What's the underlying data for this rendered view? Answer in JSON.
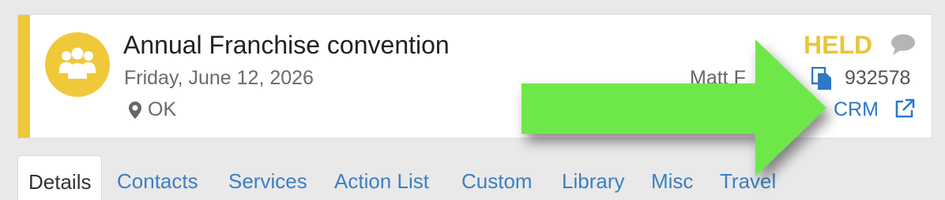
{
  "event": {
    "title": "Annual Franchise convention",
    "date": "Friday, June 12, 2026",
    "location": "OK",
    "status": "HELD",
    "owner": "Matt F",
    "doc_number": "932578",
    "crm_link": "CRM"
  },
  "tabs": [
    {
      "label": "Details",
      "active": true
    },
    {
      "label": "Contacts",
      "active": false
    },
    {
      "label": "Services",
      "active": false
    },
    {
      "label": "Action List",
      "active": false
    },
    {
      "label": "Custom",
      "active": false
    },
    {
      "label": "Library",
      "active": false
    },
    {
      "label": "Misc",
      "active": false
    },
    {
      "label": "Travel",
      "active": false
    }
  ],
  "icons": {
    "avatar": "group-icon",
    "location": "map-pin-icon",
    "comment": "comment-icon",
    "document": "copy-document-icon",
    "external": "external-link-icon"
  },
  "colors": {
    "accent": "#f0c93a",
    "status": "#eac43c",
    "link": "#2f78c6",
    "annotation_arrow": "#6ee84a"
  }
}
